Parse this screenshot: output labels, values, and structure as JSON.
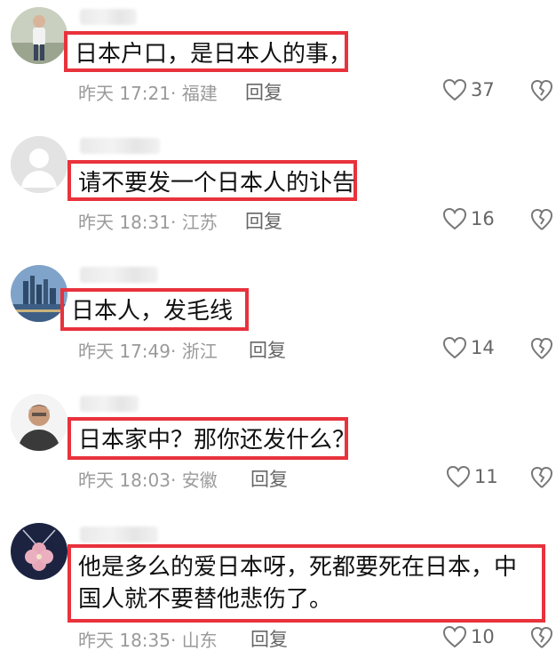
{
  "comments": [
    {
      "text": "日本户口，是日本人的事，",
      "time": "昨天 17:21",
      "location": "福建",
      "reply": "回复",
      "likes": "37",
      "avatar": "person-standing-avatar"
    },
    {
      "text": "请不要发一个日本人的讣告",
      "time": "昨天 18:31",
      "location": "江苏",
      "reply": "回复",
      "likes": "16",
      "avatar": "default-gray-avatar"
    },
    {
      "text": "日本人，发毛线",
      "time": "昨天 17:49",
      "location": "浙江",
      "reply": "回复",
      "likes": "14",
      "avatar": "city-skyline-avatar"
    },
    {
      "text": "日本家中？那你还发什么？",
      "time": "昨天 18:03",
      "location": "安徽",
      "reply": "回复",
      "likes": "11",
      "avatar": "man-portrait-avatar"
    },
    {
      "text": "他是多么的爱日本呀，死都要死在日本，中国人就不要替他悲伤了。",
      "time": "昨天 18:35",
      "location": "山东",
      "reply": "回复",
      "likes": "10",
      "avatar": "clover-pendant-avatar"
    }
  ],
  "colors": {
    "highlight_border": "#e8323c",
    "meta_text": "#9a9a9a",
    "icon_gray": "#777777"
  },
  "icons": {
    "like": "heart-outline-icon",
    "dislike": "broken-heart-icon"
  }
}
